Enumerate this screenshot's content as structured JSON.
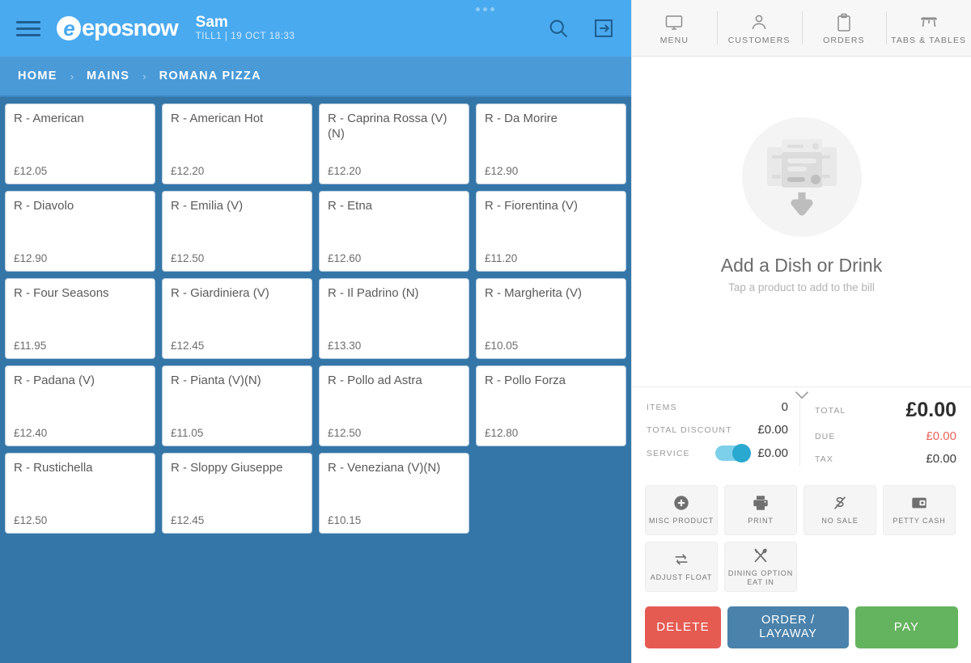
{
  "header": {
    "logo_text": "eposnow",
    "logo_mark": "e",
    "user_name": "Sam",
    "user_till": "TILL1 | 19 OCT 18:33",
    "menu_icon": "hamburger-icon",
    "more_icon": "more-dots-icon",
    "search_icon": "search-icon",
    "logout_icon": "logout-icon"
  },
  "breadcrumb": {
    "items": [
      "HOME",
      "MAINS",
      "ROMANA PIZZA"
    ],
    "separator": "›"
  },
  "products": [
    {
      "name": "R - American",
      "price": "£12.05"
    },
    {
      "name": "R - American Hot",
      "price": "£12.20"
    },
    {
      "name": "R - Caprina Rossa (V)(N)",
      "price": "£12.20"
    },
    {
      "name": "R - Da Morire",
      "price": "£12.90"
    },
    {
      "name": "R - Diavolo",
      "price": "£12.90"
    },
    {
      "name": "R - Emilia (V)",
      "price": "£12.50"
    },
    {
      "name": "R - Etna",
      "price": "£12.60"
    },
    {
      "name": "R - Fiorentina (V)",
      "price": "£11.20"
    },
    {
      "name": "R - Four Seasons",
      "price": "£11.95"
    },
    {
      "name": "R - Giardiniera (V)",
      "price": "£12.45"
    },
    {
      "name": "R - Il Padrino (N)",
      "price": "£13.30"
    },
    {
      "name": "R - Margherita (V)",
      "price": "£10.05"
    },
    {
      "name": "R - Padana (V)",
      "price": "£12.40"
    },
    {
      "name": "R - Pianta (V)(N)",
      "price": "£11.05"
    },
    {
      "name": "R - Pollo ad Astra",
      "price": "£12.50"
    },
    {
      "name": "R - Pollo Forza",
      "price": "£12.80"
    },
    {
      "name": "R - Rustichella",
      "price": "£12.50"
    },
    {
      "name": "R - Sloppy Giuseppe",
      "price": "£12.45"
    },
    {
      "name": "R - Veneziana (V)(N)",
      "price": "£10.15"
    }
  ],
  "nav": {
    "items": [
      {
        "label": "MENU",
        "icon": "monitor-icon"
      },
      {
        "label": "CUSTOMERS",
        "icon": "person-icon"
      },
      {
        "label": "ORDERS",
        "icon": "clipboard-icon"
      },
      {
        "label": "TABS & TABLES",
        "icon": "table-icon"
      }
    ]
  },
  "bill_placeholder": {
    "title": "Add a Dish or Drink",
    "subtitle": "Tap a product to add to the bill",
    "graphic": "add-items-arrow-icon"
  },
  "totals": {
    "collapse_icon": "chevron-down-icon",
    "left": [
      {
        "label": "ITEMS",
        "value": "0"
      },
      {
        "label": "TOTAL DISCOUNT",
        "value": "£0.00"
      },
      {
        "label": "SERVICE",
        "value": "£0.00",
        "toggle": true
      }
    ],
    "right": [
      {
        "label": "TOTAL",
        "value": "£0.00"
      },
      {
        "label": "DUE",
        "value": "£0.00"
      },
      {
        "label": "TAX",
        "value": "£0.00"
      }
    ]
  },
  "actions": [
    {
      "label": "MISC PRODUCT",
      "icon": "plus-circle-icon"
    },
    {
      "label": "PRINT",
      "icon": "printer-icon"
    },
    {
      "label": "NO SALE",
      "icon": "no-sale-icon"
    },
    {
      "label": "PETTY CASH",
      "icon": "wallet-icon"
    },
    {
      "label": "ADJUST FLOAT",
      "icon": "exchange-icon"
    },
    {
      "label": "DINING OPTION EAT IN",
      "icon": "cutlery-icon",
      "line1": "DINING OPTION",
      "line2": "EAT IN"
    }
  ],
  "cta": {
    "delete": "DELETE",
    "order": "ORDER / LAYAWAY",
    "order_line1": "ORDER /",
    "order_line2": "LAYAWAY",
    "pay": "PAY"
  },
  "colors": {
    "header_blue": "#4aaaf0",
    "breadcrumb_blue": "#4a9ad8",
    "grid_blue": "#3476a8",
    "delete_red": "#e55b52",
    "order_blue": "#4a82ab",
    "pay_green": "#64b35e",
    "due_red": "#e8635c",
    "toggle_on": "#29a8d0"
  }
}
